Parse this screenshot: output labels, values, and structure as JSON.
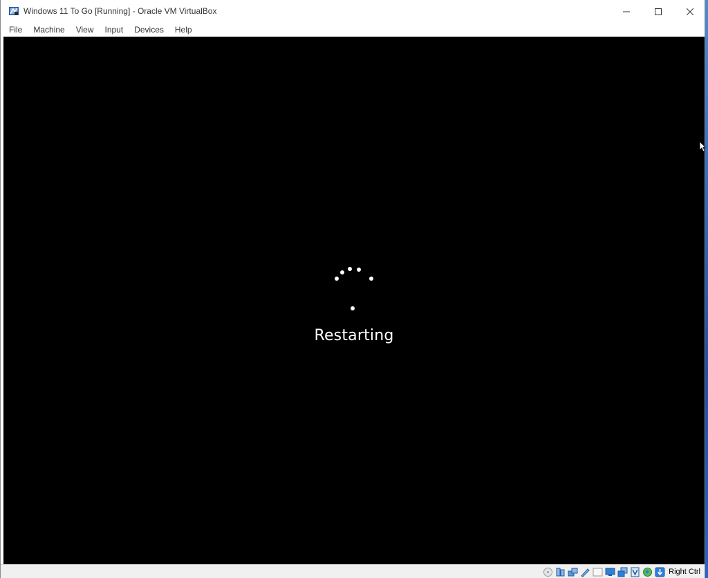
{
  "window": {
    "title": "Windows 11 To Go [Running] - Oracle VM VirtualBox",
    "icon": "virtualbox-icon"
  },
  "caption_buttons": [
    "minimize",
    "maximize",
    "close"
  ],
  "menu": {
    "items": [
      {
        "label": "File"
      },
      {
        "label": "Machine"
      },
      {
        "label": "View"
      },
      {
        "label": "Input"
      },
      {
        "label": "Devices"
      },
      {
        "label": "Help"
      }
    ]
  },
  "vm_screen": {
    "background": "#000000",
    "status_text": "Restarting",
    "spinner_icon": "loading-dots-icon"
  },
  "statusbar": {
    "host_key": "Right Ctrl",
    "icons": [
      "optical-drive-icon",
      "audio-icon",
      "network-icon",
      "usb-icon",
      "shared-folders-icon",
      "display-icon",
      "recording-icon",
      "virtualization-icon",
      "mouse-integration-icon",
      "keyboard-capture-icon"
    ]
  },
  "colors": {
    "desktop_accent": "#2a63c7",
    "close_hover": "#e81123"
  }
}
